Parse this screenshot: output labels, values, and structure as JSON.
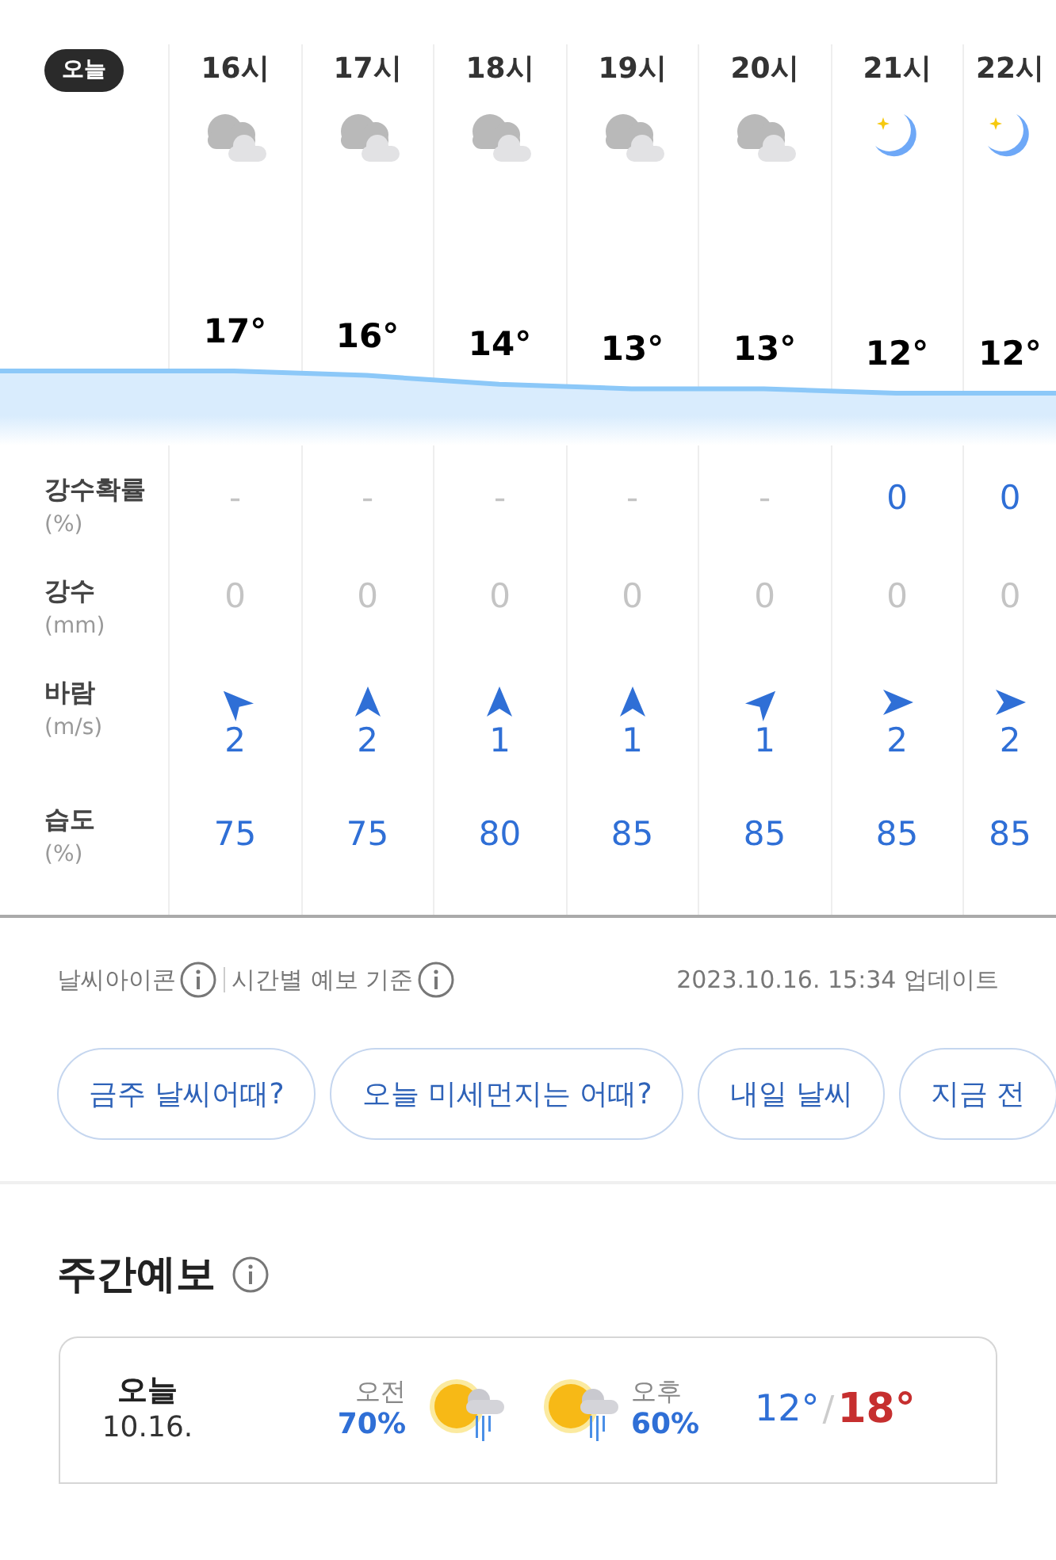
{
  "today_badge": "오늘",
  "hours": [
    {
      "label": "16시",
      "kind": "cloudy",
      "temp": "17°",
      "precip_prob": {
        "text": "-",
        "muted": true
      },
      "precip": {
        "text": "0",
        "muted": true
      },
      "wind": {
        "kind": "NW",
        "speed": "2"
      },
      "humidity": "75"
    },
    {
      "label": "17시",
      "kind": "cloudy",
      "temp": "16°",
      "precip_prob": {
        "text": "-",
        "muted": true
      },
      "precip": {
        "text": "0",
        "muted": true
      },
      "wind": {
        "kind": "N",
        "speed": "2"
      },
      "humidity": "75"
    },
    {
      "label": "18시",
      "kind": "cloudy",
      "temp": "14°",
      "precip_prob": {
        "text": "-",
        "muted": true
      },
      "precip": {
        "text": "0",
        "muted": true
      },
      "wind": {
        "kind": "N",
        "speed": "1"
      },
      "humidity": "80"
    },
    {
      "label": "19시",
      "kind": "cloudy",
      "temp": "13°",
      "precip_prob": {
        "text": "-",
        "muted": true
      },
      "precip": {
        "text": "0",
        "muted": true
      },
      "wind": {
        "kind": "N",
        "speed": "1"
      },
      "humidity": "85"
    },
    {
      "label": "20시",
      "kind": "cloudy",
      "temp": "13°",
      "precip_prob": {
        "text": "-",
        "muted": true
      },
      "precip": {
        "text": "0",
        "muted": true
      },
      "wind": {
        "kind": "NE",
        "speed": "1"
      },
      "humidity": "85"
    },
    {
      "label": "21시",
      "kind": "moon",
      "temp": "12°",
      "precip_prob": {
        "text": "0",
        "muted": false
      },
      "precip": {
        "text": "0",
        "muted": true
      },
      "wind": {
        "kind": "E",
        "speed": "2"
      },
      "humidity": "85"
    },
    {
      "label": "22시",
      "kind": "moon",
      "temp": "12°",
      "precip_prob": {
        "text": "0",
        "muted": false
      },
      "precip": {
        "text": "0",
        "muted": true
      },
      "wind": {
        "kind": "E",
        "speed": "2"
      },
      "humidity": "85"
    }
  ],
  "rows": [
    {
      "label": "강수확률",
      "unit": "(%)"
    },
    {
      "label": "강수",
      "unit": "(mm)"
    },
    {
      "label": "바람",
      "unit": "(m/s)"
    },
    {
      "label": "습도",
      "unit": "(%)"
    }
  ],
  "footer": {
    "icon_info": "날씨아이콘",
    "basis": "시간별 예보 기준",
    "updated": "2023.10.16. 15:34 업데이트"
  },
  "chips": [
    "금주 날씨어때?",
    "오늘 미세먼지는 어때?",
    "내일 날씨",
    "지금 전"
  ],
  "weekly": {
    "title": "주간예보",
    "days": [
      {
        "day": "오늘",
        "date": "10.16.",
        "am": {
          "label": "오전",
          "prob": "70%",
          "kind": "sun-rain"
        },
        "pm": {
          "kind": "sun-rain",
          "label": "오후",
          "prob": "60%"
        },
        "low": "12°",
        "separator": "/",
        "high": "18°"
      }
    ]
  }
}
